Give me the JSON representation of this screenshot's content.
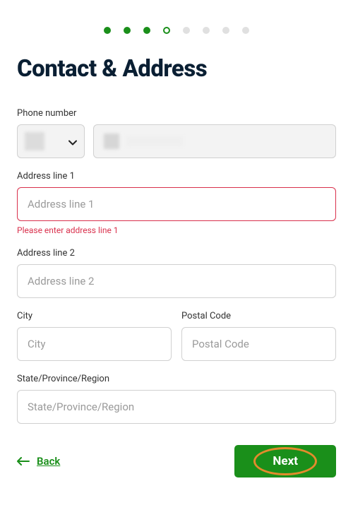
{
  "stepper": {
    "total": 8,
    "completed": 3,
    "current_index": 3
  },
  "title": "Contact & Address",
  "fields": {
    "phone": {
      "label": "Phone number"
    },
    "address1": {
      "label": "Address line 1",
      "placeholder": "Address line 1",
      "error": "Please enter address line 1"
    },
    "address2": {
      "label": "Address line 2",
      "placeholder": "Address line 2"
    },
    "city": {
      "label": "City",
      "placeholder": "City"
    },
    "postal": {
      "label": "Postal Code",
      "placeholder": "Postal Code"
    },
    "region": {
      "label": "State/Province/Region",
      "placeholder": "State/Province/Region"
    }
  },
  "footer": {
    "back_label": "Back",
    "next_label": "Next"
  },
  "colors": {
    "accent": "#1a8f1a",
    "error": "#d9304c",
    "highlight": "#e38b2c"
  }
}
